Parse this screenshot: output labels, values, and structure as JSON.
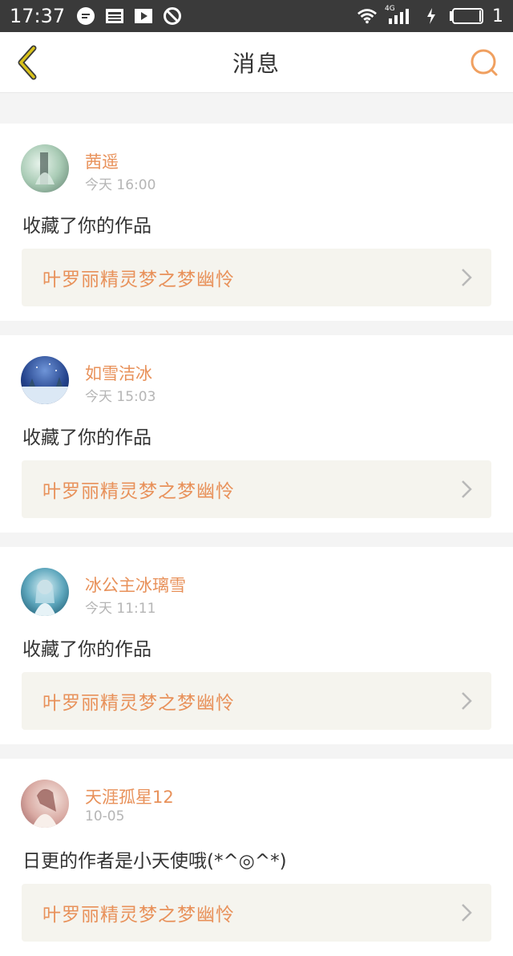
{
  "status_bar": {
    "time": "17:37",
    "network": "4G",
    "battery_level": "1",
    "icons": [
      "chat-bubble-icon",
      "news-icon",
      "video-icon",
      "blocked-icon",
      "wifi-icon",
      "signal-icon",
      "charging-icon",
      "battery-icon"
    ]
  },
  "header": {
    "title": "消息",
    "back_icon": "chevron-left-icon",
    "search_icon": "search-icon",
    "accent_back": "#c9b000",
    "accent_search": "#f0a060"
  },
  "messages": [
    {
      "user": "茜遥",
      "time": "今天 16:00",
      "text": "收藏了你的作品",
      "work": "叶罗丽精灵梦之梦幽怜",
      "avatar_colors": [
        "#cfe8d8",
        "#7a9c8a"
      ]
    },
    {
      "user": "如雪洁冰",
      "time": "今天 15:03",
      "text": "收藏了你的作品",
      "work": "叶罗丽精灵梦之梦幽怜",
      "avatar_colors": [
        "#1d3a7a",
        "#8fb2e0"
      ]
    },
    {
      "user": "冰公主冰璃雪",
      "time": "今天 11:11",
      "text": "收藏了你的作品",
      "work": "叶罗丽精灵梦之梦幽怜",
      "avatar_colors": [
        "#0f5e78",
        "#c8e8f0"
      ]
    },
    {
      "user": "天涯孤星12",
      "time": "10-05",
      "text": "日更的作者是小天使哦(*^◎^*)",
      "work": "叶罗丽精灵梦之梦幽怜",
      "avatar_colors": [
        "#c98f8a",
        "#f2dcd4"
      ]
    }
  ],
  "colors": {
    "accent_name": "#e8915a",
    "secondary_text": "#b5b5b5",
    "link_bg": "#f5f4ee"
  }
}
